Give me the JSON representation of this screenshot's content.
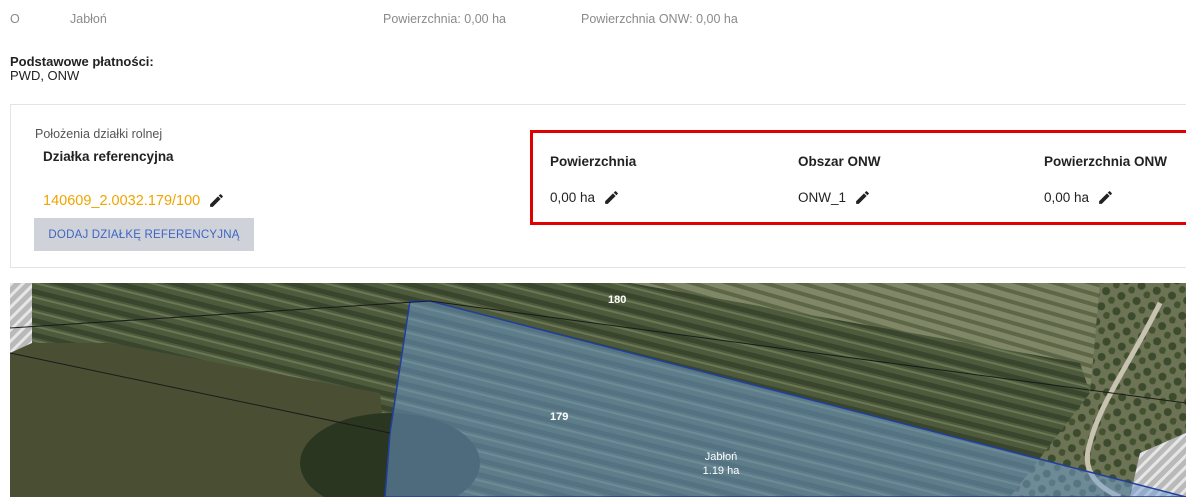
{
  "header_row": {
    "letter": "O",
    "crop": "Jabłoń",
    "area": "Powierzchnia: 0,00 ha",
    "onw_area": "Powierzchnia ONW: 0,00 ha"
  },
  "basic_payments": {
    "title": "Podstawowe płatności:",
    "value": "PWD, ONW"
  },
  "location": {
    "caption": "Położenia działki rolnej",
    "ref_title": "Działka referencyjna",
    "ref_value": "140609_2.0032.179/100",
    "add_button": "DODAJ DZIAŁKĘ REFERENCYJNĄ",
    "ref_color": "#f0a500"
  },
  "columns": [
    {
      "header": "Powierzchnia",
      "value": "0,00 ha"
    },
    {
      "header": "Obszar ONW",
      "value": "ONW_1"
    },
    {
      "header": "Powierzchnia ONW",
      "value": "0,00 ha"
    }
  ],
  "map": {
    "label_180": "180",
    "label_179": "179",
    "parcel_crop": "Jabłoń",
    "parcel_area": "1.19 ha"
  },
  "colors": {
    "highlight": "#e00000",
    "button_bg": "#cfd3d9",
    "button_text": "#3f64c2",
    "parcel_fill": "#6f9fd8"
  }
}
